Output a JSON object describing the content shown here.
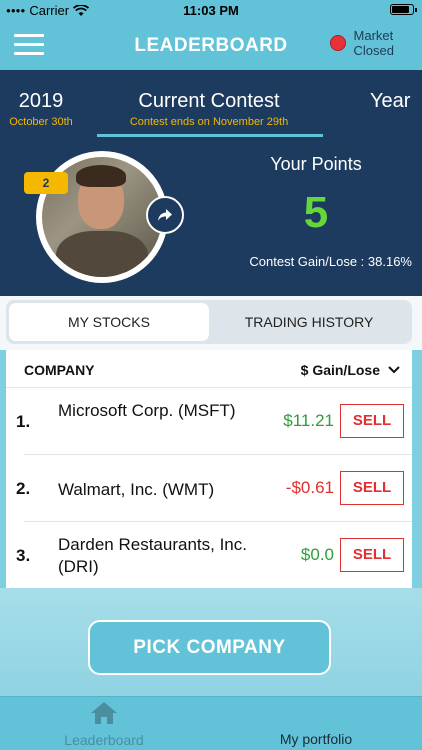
{
  "status_bar": {
    "carrier": "Carrier",
    "time": "11:03 PM",
    "battery_level": 0.9
  },
  "header": {
    "title": "LEADERBOARD",
    "market_status_line1": "Market",
    "market_status_line2": "Closed",
    "market_status_color": "#e8323a"
  },
  "contests": [
    {
      "title": "2019",
      "subtitle": "October 30th"
    },
    {
      "title": "Current Contest",
      "subtitle": "Contest ends on November 29th"
    },
    {
      "title": "Year",
      "subtitle": ""
    }
  ],
  "profile": {
    "rank": "2",
    "points_label": "Your Points",
    "points": "5",
    "gain_text": "Contest Gain/Lose : 38.16%"
  },
  "segments": {
    "active": "MY STOCKS",
    "inactive": "TRADING HISTORY"
  },
  "table": {
    "company_header": "COMPANY",
    "gain_header": "$ Gain/Lose",
    "rows": [
      {
        "num": "1.",
        "name": "Microsoft Corp. (MSFT)",
        "gain": "$11.21",
        "gain_color": "#2e9e3a",
        "action": "SELL"
      },
      {
        "num": "2.",
        "name": "Walmart, Inc. (WMT)",
        "gain": "-$0.61",
        "gain_color": "#e03030",
        "action": "SELL"
      },
      {
        "num": "3.",
        "name": "Darden Restaurants, Inc. (DRI)",
        "gain": "$0.0",
        "gain_color": "#2e9e3a",
        "action": "SELL"
      }
    ]
  },
  "pick_button": "PICK COMPANY",
  "tab_bar": {
    "leaderboard": "Leaderboard",
    "portfolio": "My portfolio"
  },
  "colors": {
    "accent": "#62c3d8",
    "navy": "#1d3b5e",
    "points": "#67d63a",
    "badge": "#f4b800"
  }
}
